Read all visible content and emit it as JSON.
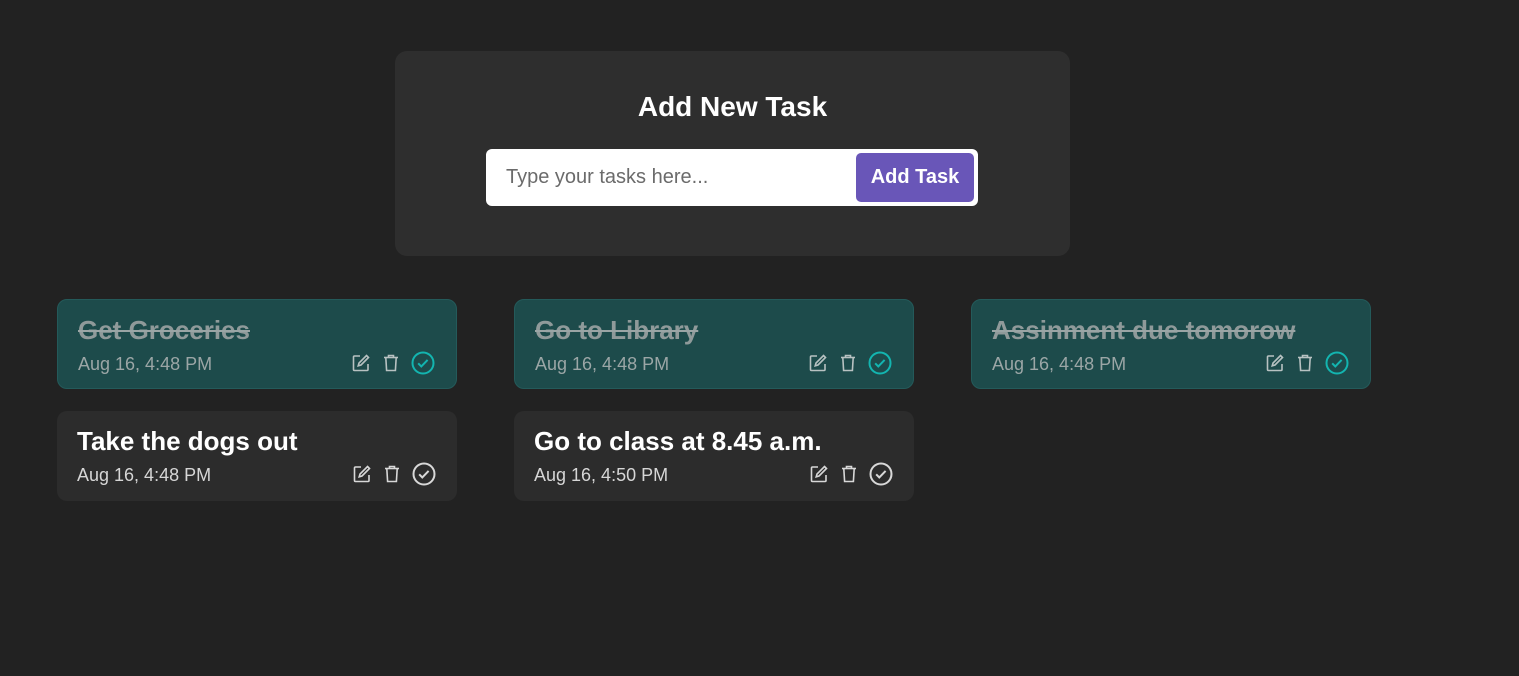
{
  "panel": {
    "title": "Add New Task",
    "input_value": "",
    "input_placeholder": "Type your tasks here...",
    "button_label": "Add Task"
  },
  "colors": {
    "page_background": "#222222",
    "panel_background": "#2e2e2e",
    "accent_button": "#6956b8",
    "completed_card": "#1d4b4b",
    "pending_card": "#2c2c2c",
    "check_completed": "#13b5b0",
    "check_pending": "#d8d8d8"
  },
  "tasks": [
    {
      "title": "Get Groceries",
      "date": "Aug 16, 4:48 PM",
      "completed": true
    },
    {
      "title": "Go to Library",
      "date": "Aug 16, 4:48 PM",
      "completed": true
    },
    {
      "title": "Assinment due tomorow",
      "date": "Aug 16, 4:48 PM",
      "completed": true
    },
    {
      "title": "Take the dogs out",
      "date": "Aug 16, 4:48 PM",
      "completed": false
    },
    {
      "title": "Go to class at 8.45 a.m.",
      "date": "Aug 16, 4:50 PM",
      "completed": false
    }
  ],
  "icons": [
    "edit-icon",
    "trash-icon",
    "check-circle-icon"
  ]
}
